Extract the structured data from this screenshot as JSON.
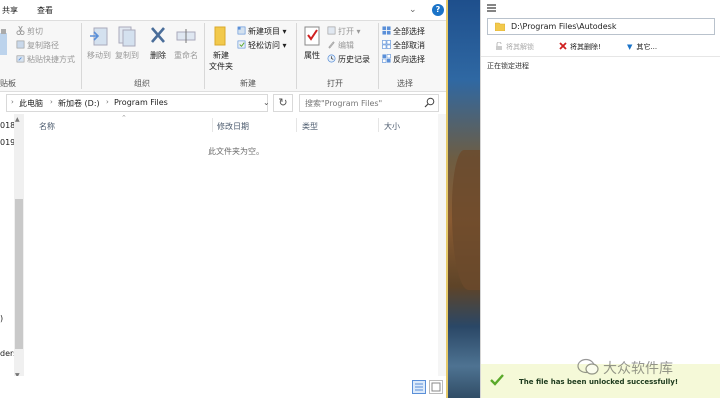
{
  "explorer": {
    "menu_tabs": [
      "共享",
      "查看"
    ],
    "ribbon": {
      "clipboard": {
        "cut": "剪切",
        "copy_path": "复制路径",
        "paste_shortcut": "粘贴快捷方式",
        "group_label": "贴板"
      },
      "organize": {
        "move_to": "移动到",
        "copy_to": "复制到",
        "delete": "删除",
        "rename": "重命名",
        "group_label": "组织"
      },
      "new": {
        "new_folder_line1": "新建",
        "new_folder_line2": "文件夹",
        "new_item": "新建项目",
        "easy_access": "轻松访问",
        "group_label": "新建"
      },
      "open": {
        "properties": "属性",
        "open": "打开",
        "edit": "编辑",
        "history": "历史记录",
        "group_label": "打开"
      },
      "select": {
        "select_all": "全部选择",
        "select_none": "全部取消",
        "invert_selection": "反向选择",
        "group_label": "选择"
      }
    },
    "address": {
      "crumbs": [
        "此电脑",
        "新加卷 (D:)",
        "Program Files"
      ],
      "search_placeholder": "搜索\"Program Files\""
    },
    "nav_items": [
      "018",
      "019",
      ")",
      "ders"
    ],
    "columns": [
      "名称",
      "修改日期",
      "类型",
      "大小"
    ],
    "empty_message": "此文件夹为空。"
  },
  "unlocker": {
    "path": "D:\\Program Files\\Autodesk",
    "actions": {
      "unlock": "将其解锁",
      "delete": "将其删除!",
      "other": "其它..."
    },
    "status_locking": "正在锁定进程",
    "success_message": "The file has been unlocked successfully!"
  },
  "watermark": {
    "text": "大众软件库"
  },
  "colors": {
    "accent_blue": "#1a73c8",
    "delete_red": "#d02020",
    "success_bg": "#f5f9d8",
    "success_check": "#5aa92a",
    "folder_yellow": "#f2c94c"
  }
}
